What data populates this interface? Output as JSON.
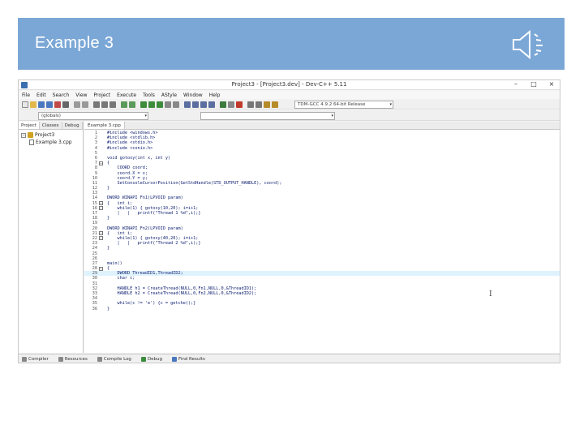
{
  "slide": {
    "title": "Example 3"
  },
  "ide": {
    "window_title": "Project3 - [Project3.dev] - Dev-C++ 5.11",
    "window_buttons": [
      "–",
      "□",
      "×"
    ],
    "menu": [
      "File",
      "Edit",
      "Search",
      "View",
      "Project",
      "Execute",
      "Tools",
      "AStyle",
      "Window",
      "Help"
    ],
    "compiler_select": "TDM-GCC 4.9.2 64-bit Release",
    "scope_combo": "(globals)",
    "second_combo": "",
    "panel_tabs": [
      "Project",
      "Classes",
      "Debug"
    ],
    "project_tree": {
      "root": "Project3",
      "root_toggle": "−",
      "children": [
        "Example 3.cpp"
      ]
    },
    "editor_tab": "Example 3.cpp",
    "code_lines": [
      {
        "n": "1",
        "fold": "",
        "text": "#include <windows.h>"
      },
      {
        "n": "2",
        "fold": "",
        "text": "#include <stdlib.h>"
      },
      {
        "n": "3",
        "fold": "",
        "text": "#include <stdio.h>"
      },
      {
        "n": "4",
        "fold": "",
        "text": "#include <conio.h>"
      },
      {
        "n": "5",
        "fold": "",
        "text": ""
      },
      {
        "n": "6",
        "fold": "",
        "text": "void gotoxy(int x, int y)"
      },
      {
        "n": "7",
        "fold": "−",
        "text": "{"
      },
      {
        "n": "8",
        "fold": "",
        "text": "    COORD coord;"
      },
      {
        "n": "9",
        "fold": "",
        "text": "    coord.X = x;"
      },
      {
        "n": "10",
        "fold": "",
        "text": "    coord.Y = y;"
      },
      {
        "n": "11",
        "fold": "",
        "text": "    SetConsoleCursorPosition(GetStdHandle(STD_OUTPUT_HANDLE), coord);"
      },
      {
        "n": "12",
        "fold": "",
        "text": "}"
      },
      {
        "n": "13",
        "fold": "",
        "text": ""
      },
      {
        "n": "14",
        "fold": "",
        "text": "DWORD WINAPI Fn1(LPVOID param)"
      },
      {
        "n": "15",
        "fold": "−",
        "text": "{   int i;"
      },
      {
        "n": "16",
        "fold": "−",
        "text": "    while(1) { gotoxy(10,20); i=i+1;"
      },
      {
        "n": "17",
        "fold": "",
        "text": "    |   |   printf(\"Thread 1 %d\",i);}"
      },
      {
        "n": "18",
        "fold": "",
        "text": "}"
      },
      {
        "n": "19",
        "fold": "",
        "text": ""
      },
      {
        "n": "20",
        "fold": "",
        "text": "DWORD WINAPI Fn2(LPVOID param)"
      },
      {
        "n": "21",
        "fold": "−",
        "text": "{   int i;"
      },
      {
        "n": "22",
        "fold": "−",
        "text": "    while(1) { gotoxy(40,20); i=i+1;"
      },
      {
        "n": "23",
        "fold": "",
        "text": "    |   |   printf(\"Thread 2 %d\",i);}"
      },
      {
        "n": "24",
        "fold": "",
        "text": "}"
      },
      {
        "n": "25",
        "fold": "",
        "text": ""
      },
      {
        "n": "26",
        "fold": "",
        "text": ""
      },
      {
        "n": "27",
        "fold": "",
        "text": "main()"
      },
      {
        "n": "28",
        "fold": "−",
        "text": "{"
      },
      {
        "n": "29",
        "fold": "",
        "text": "    DWORD ThreadID1,ThreadID2;",
        "highlight": true
      },
      {
        "n": "30",
        "fold": "",
        "text": "    char c;"
      },
      {
        "n": "31",
        "fold": "",
        "text": ""
      },
      {
        "n": "32",
        "fold": "",
        "text": "    HANDLE h1 = CreateThread(NULL,0,Fn1,NULL,0,&ThreadID1);"
      },
      {
        "n": "33",
        "fold": "",
        "text": "    HANDLE h2 = CreateThread(NULL,0,Fn2,NULL,0,&ThreadID2);"
      },
      {
        "n": "34",
        "fold": "",
        "text": ""
      },
      {
        "n": "35",
        "fold": "",
        "text": "    while(c != 'e') {c = getche();}"
      },
      {
        "n": "36",
        "fold": "",
        "text": "}"
      }
    ],
    "bottom_tabs": [
      "Compiler",
      "Resources",
      "Compile Log",
      "Debug",
      "Find Results"
    ],
    "text_cursor": "I"
  },
  "colors": {
    "banner": "#7ba7d6",
    "highlight_line": "#dff3ff"
  }
}
